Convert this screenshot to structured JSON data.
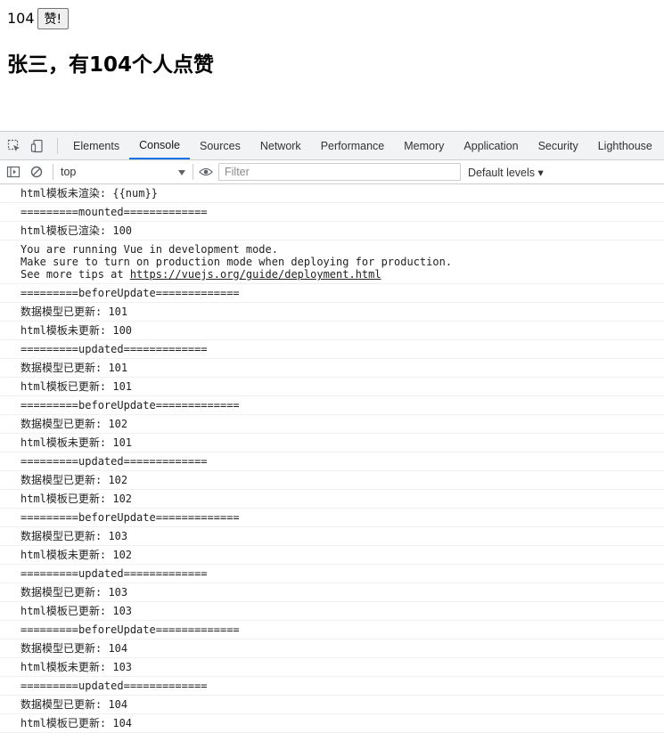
{
  "page": {
    "count": "104",
    "like_button": "赞!",
    "heading": "张三，有104个人点赞"
  },
  "devtools": {
    "tabs": [
      "Elements",
      "Console",
      "Sources",
      "Network",
      "Performance",
      "Memory",
      "Application",
      "Security",
      "Lighthouse"
    ],
    "active_tab": "Console",
    "context": "top",
    "filter_placeholder": "Filter",
    "levels": "Default levels ▾",
    "colors": {
      "accent": "#1a73e8",
      "tab_bg": "#f1f3f4",
      "border": "#cbcdd1"
    }
  },
  "console": {
    "messages": [
      "html模板未渲染: {{num}}",
      "=========mounted=============",
      "html模板已渲染: 100",
      {
        "lines": [
          "You are running Vue in development mode.",
          "Make sure to turn on production mode when deploying for production."
        ],
        "prefix": "See more tips at ",
        "link": "https://vuejs.org/guide/deployment.html"
      },
      "=========beforeUpdate=============",
      "数据模型已更新: 101",
      "html模板未更新: 100",
      "=========updated=============",
      "数据模型已更新: 101",
      "html模板已更新: 101",
      "=========beforeUpdate=============",
      "数据模型已更新: 102",
      "html模板未更新: 101",
      "=========updated=============",
      "数据模型已更新: 102",
      "html模板已更新: 102",
      "=========beforeUpdate=============",
      "数据模型已更新: 103",
      "html模板未更新: 102",
      "=========updated=============",
      "数据模型已更新: 103",
      "html模板已更新: 103",
      "=========beforeUpdate=============",
      "数据模型已更新: 104",
      "html模板未更新: 103",
      "=========updated=============",
      "数据模型已更新: 104",
      "html模板已更新: 104"
    ]
  }
}
